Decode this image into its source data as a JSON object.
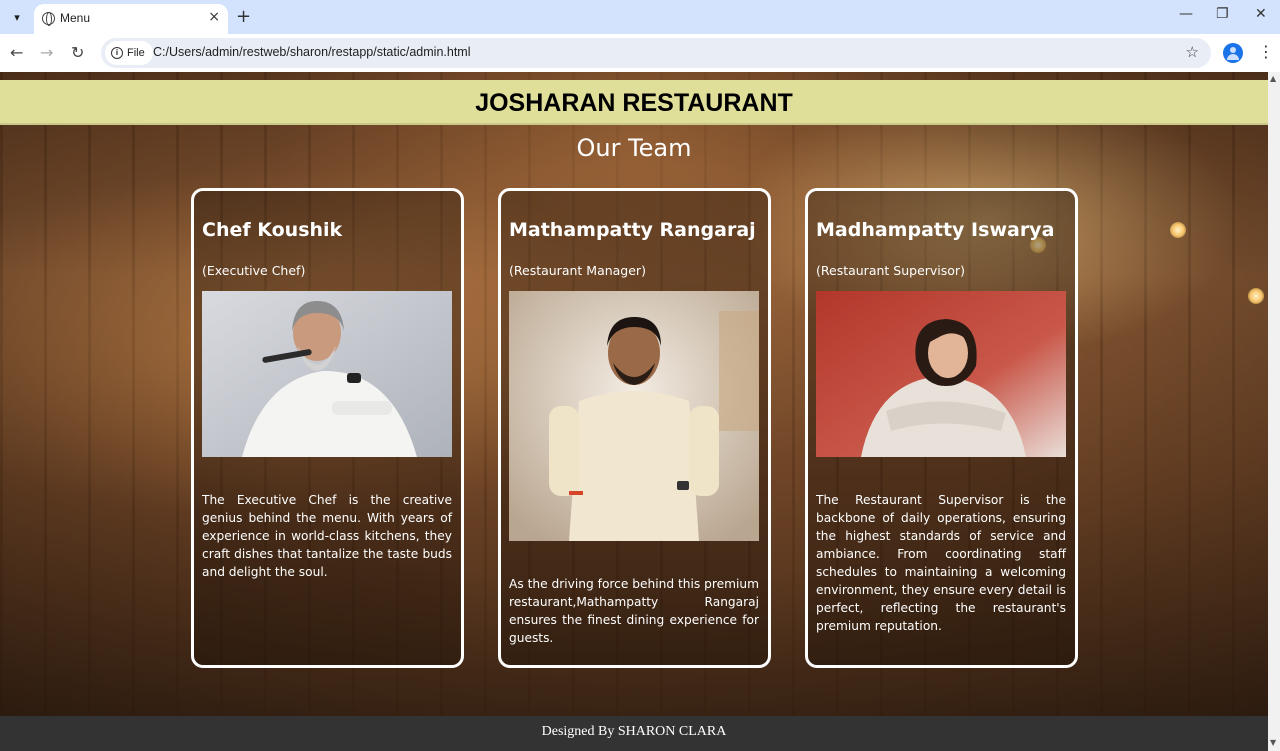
{
  "browser": {
    "tab_title": "Menu",
    "new_tab": "+",
    "close_tab": "×",
    "site_chip": "File",
    "url": "C:/Users/admin/restweb/sharon/restapp/static/admin.html",
    "window_buttons": [
      "—",
      "❐",
      "✕"
    ]
  },
  "page": {
    "site_title": "JOSHARAN RESTAURANT",
    "section_title": "Our Team",
    "team": [
      {
        "name": "Chef Koushik",
        "role": "(Executive Chef)",
        "description": "The Executive Chef is the creative genius behind the menu. With years of experience in world-class kitchens, they craft dishes that tantalize the taste buds and delight the soul."
      },
      {
        "name": "Mathampatty Rangaraj",
        "role": "(Restaurant Manager)",
        "description": "As the driving force behind this premium restaurant,Mathampatty Rangaraj ensures the finest dining experience for guests."
      },
      {
        "name": "Madhampatty Iswarya",
        "role": "(Restaurant Supervisor)",
        "description": "The Restaurant Supervisor is the backbone of daily operations, ensuring the highest standards of service and ambiance. From coordinating staff schedules to maintaining a welcoming environment, they ensure every detail is perfect, reflecting the restaurant's premium reputation."
      }
    ],
    "footer": "Designed By SHARON CLARA"
  },
  "colors": {
    "header_band": "#e0df9a",
    "footer_bg": "#333333",
    "card_border": "#ffffff",
    "tabbar": "#d3e3fd"
  }
}
